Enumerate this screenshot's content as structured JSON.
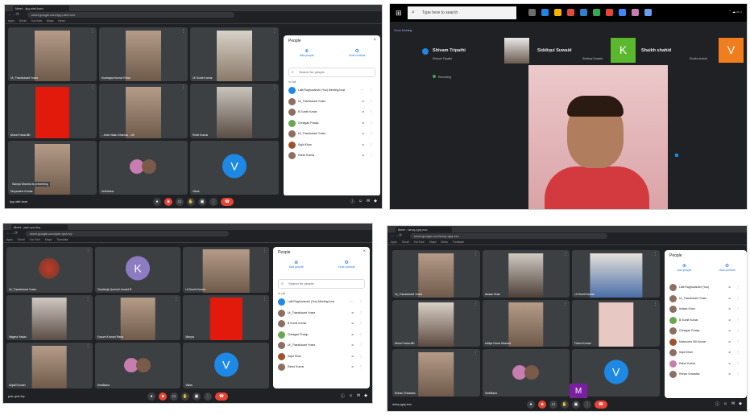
{
  "screens": {
    "top_left": {
      "tab_title": "Meet - lyq-rdef-hxm",
      "url": "meet.google.com/lyq-rdef-hxm",
      "tiles": [
        {
          "name": "Ut_Thandukant Yvaez",
          "kind": "cam"
        },
        {
          "name": "Kushagra Kumar Rana",
          "kind": "cam"
        },
        {
          "name": "Ut Sumit Kumar",
          "kind": "cam"
        },
        {
          "name": "Mirza Fraha 8th",
          "kind": "red"
        },
        {
          "name": "...bhis Hidan Sharma ...rth",
          "kind": "cam"
        },
        {
          "name": "Rohit Kumar",
          "kind": "cam"
        },
        {
          "name": "Divyanshu Kumar",
          "kind": "cam"
        },
        {
          "name": "Ambikans",
          "kind": "pair"
        },
        {
          "name": "Vikas",
          "kind": "avatar",
          "letter": "V",
          "color": "#1e88e5"
        }
      ],
      "toast": "Saniya Sharma is presenting",
      "meeting_code": "lyq-rdef-hxm",
      "people": [
        "Lalit Raghuvanshi (You) Meeting host",
        "Ut_Thandukant Yvaez",
        "B Sumit Kumar",
        "Chhagan Pratap",
        "Ut_Thandukant Yvaez",
        "Sajid Khan",
        "Rahul Kumar"
      ]
    },
    "top_right": {
      "search_placeholder": "Type here to search",
      "meet_brand": "Zoom Meeting",
      "film": [
        {
          "name": "Shivam Tripathi",
          "sub": "Shivam Tripathi"
        },
        {
          "name": "Siddiqui Suwaid",
          "sub": "Siddiqui Suwaid",
          "letter": "K",
          "color": "#5bb82e"
        },
        {
          "name": "Shaikh shahid",
          "sub": "Shaikh shahid",
          "letter": "V",
          "color": "#f07d1e"
        }
      ],
      "pinned": "Recording"
    },
    "bottom_left": {
      "tab_title": "Meet - pwr-rpci-fvy",
      "url": "meet.google.com/pwr-rpci-fvy",
      "tiles": [
        {
          "name": "Ut_Thandukant Yvaez",
          "kind": "ring"
        },
        {
          "name": "Khadeeja Qureshi Junaid B",
          "kind": "avatar",
          "letter": "K",
          "color": "#8e7cc3"
        },
        {
          "name": "Ut Sumit Kumar",
          "kind": "cam"
        },
        {
          "name": "Nagma Yadav",
          "kind": "cam"
        },
        {
          "name": "Kusum Kumari Rana",
          "kind": "cam"
        },
        {
          "name": "Manya",
          "kind": "red"
        },
        {
          "name": "Anjali Kumari",
          "kind": "cam"
        },
        {
          "name": "Ambikans",
          "kind": "pair"
        },
        {
          "name": "Vikas",
          "kind": "avatar",
          "letter": "V",
          "color": "#1e88e5"
        }
      ],
      "meeting_code": "pwr-rpci-fvy",
      "people": [
        "Lalit Raghuvanshi (You) Meeting host",
        "Ut_Thandukant Yvaez",
        "B Sumit Kumar",
        "Chhagan Pratap",
        "Ut_Thandukant Yvaez",
        "Sajid Khan",
        "Rahul Kumar"
      ]
    },
    "bottom_right": {
      "tab_title": "Meet - wmq-rgnj-ezc",
      "url": "meet.google.com/wmq-rgnj-ezc",
      "tiles": [
        {
          "name": "Ut_Thandukant Yvaez",
          "kind": "cam"
        },
        {
          "name": "Ishaan Khan",
          "kind": "cam"
        },
        {
          "name": "Ut Sumit Kumar",
          "kind": "cam"
        },
        {
          "name": "Mirza Fraha 8th",
          "kind": "cam"
        },
        {
          "name": "Aditya Rana Sharma",
          "kind": "cam"
        },
        {
          "name": "Rahul Kumar",
          "kind": "pink"
        },
        {
          "name": "Rohan Srivastav",
          "kind": "cam"
        },
        {
          "name": "Ambikans",
          "kind": "pair"
        },
        {
          "name": "Vikas",
          "kind": "avatar",
          "letter": "V",
          "color": "#1e88e5"
        }
      ],
      "popup": "M",
      "meeting_code": "wmq-rgnj-ezc",
      "people": [
        "Lalit Raghuvanshi (You)",
        "Ut_Thandukant Yvaez",
        "Ishaan Khan",
        "B Sumit Kumar",
        "Chhagan Pratap",
        "Mahendra Gill Kumar",
        "Sajid Khan",
        "Rahul Kumar",
        "Rohan Srivastav"
      ]
    }
  },
  "labels": {
    "people_title": "People",
    "add_people": "Add people",
    "host_controls": "Host controls",
    "search_people": "Search for people",
    "in_call": "In call",
    "bookmarks": [
      "Apps",
      "Gmail",
      "YouTube",
      "Maps",
      "News",
      "Translate"
    ]
  }
}
